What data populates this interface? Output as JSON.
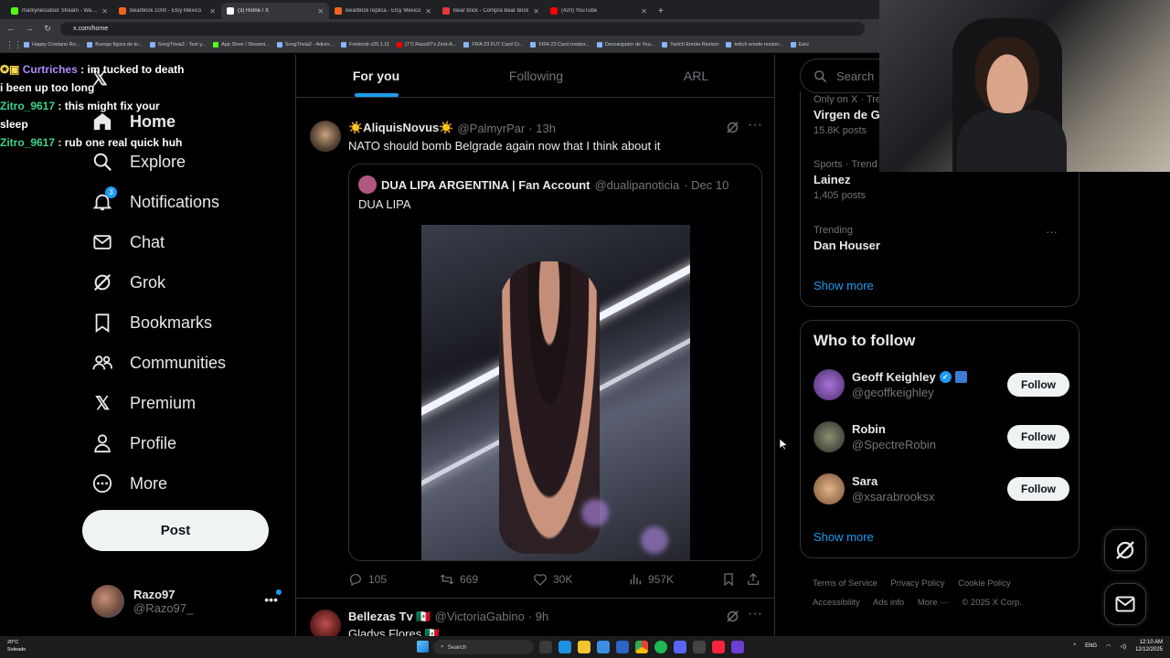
{
  "browser": {
    "tabs": [
      {
        "label": "markynessdoor Stream - Watch",
        "color": "#53fc18",
        "active": false
      },
      {
        "label": "Bearbrick 1000 - Etsy México",
        "color": "#f1641e",
        "active": false
      },
      {
        "label": "(3) Home / X",
        "color": "#ffffff",
        "active": true
      },
      {
        "label": "Bearbrick replica - Etsy México",
        "color": "#f1641e",
        "active": false
      },
      {
        "label": "Bear brick - Compra Bear brick",
        "color": "#e53935",
        "active": false
      },
      {
        "label": "(420) YouTube",
        "color": "#ff0000",
        "active": false
      }
    ],
    "url": "x.com/home",
    "bookmarks": [
      "Happy Cristiano Ro...",
      "Burego figura de to...",
      "SongTrivia2 - Test y...",
      "App Store / Streami...",
      "SongTrivia2 - Adivin...",
      "Fotetoob v25.1.11",
      "(77) Razo97's Zest-A...",
      "FIFA 23 FUT Card Cr...",
      "FIFA 23 Card creator...",
      "Descargador de You...",
      "Twitch Emote Resizer",
      "twitch emote resizer...",
      "Estu"
    ]
  },
  "chat": [
    {
      "user": "Curtriches",
      "message": ": im tucked to death",
      "continuation": "i been up too long"
    },
    {
      "user": "Zitro_9617",
      "message": ": this might fix your",
      "continuation": "sleep"
    },
    {
      "user": "Zitro_9617",
      "message": ": rub one real quick huh",
      "continuation": ""
    }
  ],
  "nav": {
    "items": [
      {
        "label": "Home",
        "icon": "home-icon"
      },
      {
        "label": "Explore",
        "icon": "search-icon"
      },
      {
        "label": "Notifications",
        "icon": "bell-icon",
        "badge": "3"
      },
      {
        "label": "Chat",
        "icon": "mail-icon"
      },
      {
        "label": "Grok",
        "icon": "grok-icon"
      },
      {
        "label": "Bookmarks",
        "icon": "bookmark-icon"
      },
      {
        "label": "Communities",
        "icon": "communities-icon"
      },
      {
        "label": "Premium",
        "icon": "x-logo-icon"
      },
      {
        "label": "Profile",
        "icon": "person-icon"
      },
      {
        "label": "More",
        "icon": "more-circle-icon"
      }
    ],
    "post_label": "Post",
    "account": {
      "name": "Razo97",
      "handle": "@Razo97_"
    }
  },
  "feed": {
    "tabs": [
      "For you",
      "Following",
      "ARL"
    ],
    "tweet": {
      "name": "☀️AliquisNovus☀️",
      "handle": "@PalmyrPar",
      "time": "· 13h",
      "text": "NATO should bomb Belgrade again now that I think about it",
      "quote": {
        "name": "DUA LIPA ARGENTINA | Fan Account",
        "handle": "@dualipanoticia",
        "time": "· Dec 10",
        "text": "DUA LIPA"
      },
      "replies": "105",
      "reposts": "669",
      "likes": "30K",
      "views": "957K"
    },
    "tweet2": {
      "name": "Bellezas Tv 🇲🇽",
      "handle": "@VictoriaGabino",
      "time": "· 9h",
      "text": "Gladys Flores 🇲🇽"
    }
  },
  "sidebar": {
    "search_placeholder": "Search",
    "trends": [
      {
        "meta": "Only on X · Tre",
        "title": "Virgen de G",
        "count": "15.8K posts"
      },
      {
        "meta": "Sports · Trend",
        "title": "Lainez",
        "count": "1,405 posts"
      },
      {
        "meta": "Trending",
        "title": "Dan Houser",
        "count": ""
      }
    ],
    "show_more": "Show more",
    "who_to_follow": {
      "title": "Who to follow",
      "users": [
        {
          "name": "Geoff Keighley",
          "handle": "@geoffkeighley",
          "button": "Follow",
          "verified": true
        },
        {
          "name": "Robin",
          "handle": "@SpectreRobin",
          "button": "Follow",
          "verified": false
        },
        {
          "name": "Sara",
          "handle": "@xsarabrooksx",
          "button": "Follow",
          "verified": false
        }
      ],
      "show_more": "Show more"
    },
    "footer": [
      "Terms of Service",
      "Privacy Policy",
      "Cookie Policy",
      "Accessibility",
      "Ads info",
      "More ···",
      "© 2025 X Corp."
    ]
  },
  "taskbar": {
    "weather_temp": "20°C",
    "weather_desc": "Soleado",
    "search_label": "Search",
    "lang": "ENG",
    "time": "12:10 AM",
    "date": "12/12/2025"
  },
  "colors": {
    "accent": "#1d9bf0",
    "background": "#000000",
    "border": "#2f3336",
    "muted": "#71767b"
  }
}
